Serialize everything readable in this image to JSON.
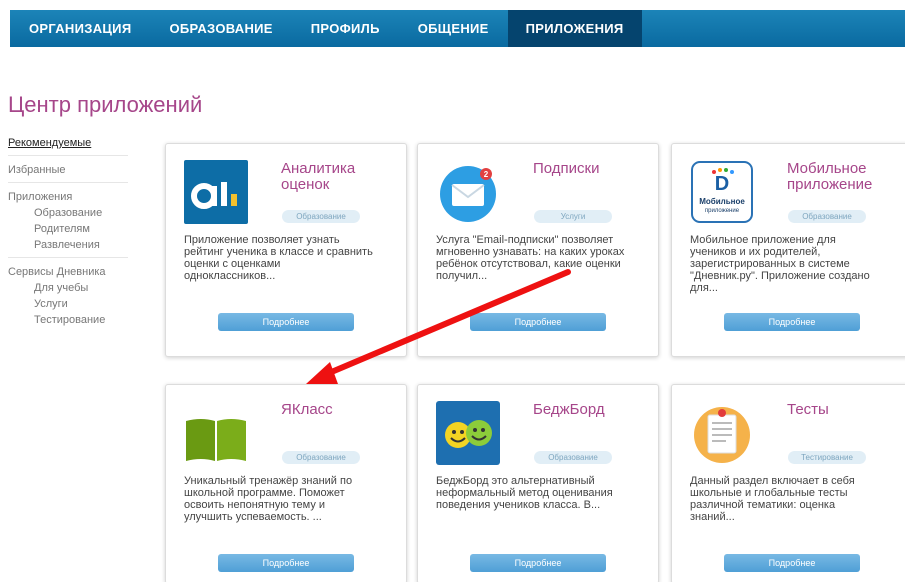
{
  "nav": {
    "items": [
      {
        "label": "ОРГАНИЗАЦИЯ"
      },
      {
        "label": "ОБРАЗОВАНИЕ"
      },
      {
        "label": "ПРОФИЛЬ"
      },
      {
        "label": "ОБЩЕНИЕ"
      },
      {
        "label": "ПРИЛОЖЕНИЯ",
        "active": true
      }
    ]
  },
  "page": {
    "title": "Центр приложений"
  },
  "sidebar": {
    "recommended": "Рекомендуемые",
    "favorites": "Избранные",
    "apps": "Приложения",
    "apps_education": "Образование",
    "apps_parents": "Родителям",
    "apps_fun": "Развлечения",
    "services": "Сервисы Дневника",
    "svc_study": "Для учебы",
    "svc_services": "Услуги",
    "svc_testing": "Тестирование"
  },
  "cards": [
    {
      "title": "Аналитика оценок",
      "category": "Образование",
      "description": "Приложение позволяет узнать рейтинг ученика в классе и сравнить оценки с оценками одноклассников...",
      "button": "Подробнее",
      "icon": "analytics-icon"
    },
    {
      "title": "Подписки",
      "category": "Услуги",
      "description": "Услуга \"Email-подписки\" позволяет мгновенно узнавать: на каких уроках ребёнок отсутствовал, какие оценки получил...",
      "button": "Подробнее",
      "icon": "mail-icon",
      "badge": "2"
    },
    {
      "title": "Мобильное приложение",
      "category": "Образование",
      "description": "Мобильное приложение для учеников и их родителей, зарегистрированных в системе \"Дневник.ру\". Приложение создано для...",
      "button": "Подробнее",
      "icon": "mobile-app-icon",
      "icon_text": "Мобильное",
      "icon_subtext": "приложение"
    },
    {
      "title": "ЯКласс",
      "category": "Образование",
      "description": "Уникальный тренажёр знаний по школьной программе. Поможет освоить непонятную тему и улучшить успеваемость. ...",
      "button": "Подробнее",
      "icon": "book-icon"
    },
    {
      "title": "БеджБорд",
      "category": "Образование",
      "description": "БеджБорд это альтернативный неформальный метод оценивания поведения учеников класса. В...",
      "button": "Подробнее",
      "icon": "smileys-icon"
    },
    {
      "title": "Тесты",
      "category": "Тестирование",
      "description": "Данный раздел включает в себя школьные и глобальные тесты различной тематики: оценка знаний...",
      "button": "Подробнее",
      "icon": "notepad-icon"
    }
  ],
  "colors": {
    "nav_bg": "#0a6aa0",
    "nav_active": "#05446e",
    "title": "#a6468a",
    "button": "#5aa8dc",
    "arrow": "#ee1111"
  }
}
